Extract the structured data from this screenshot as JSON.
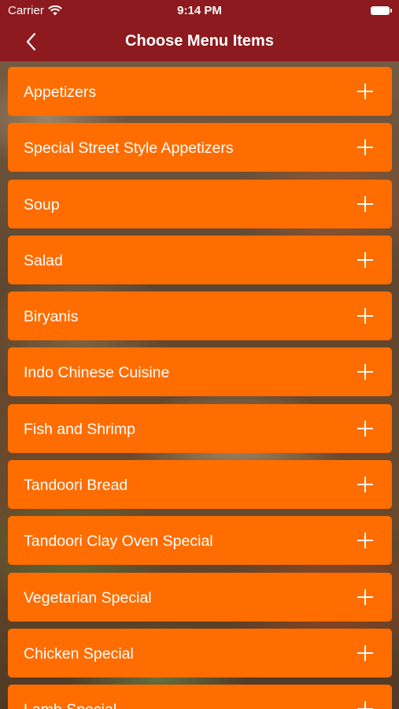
{
  "status_bar": {
    "carrier": "Carrier",
    "time": "9:14 PM"
  },
  "nav": {
    "title": "Choose Menu Items"
  },
  "colors": {
    "nav_background": "#8c1a1f",
    "item_background": "#ff6d00",
    "text": "#ffffff"
  },
  "menu_items": [
    {
      "label": "Appetizers",
      "icon": "plus-icon"
    },
    {
      "label": "Special Street Style Appetizers",
      "icon": "plus-icon"
    },
    {
      "label": "Soup",
      "icon": "plus-icon"
    },
    {
      "label": "Salad",
      "icon": "plus-icon"
    },
    {
      "label": "Biryanis",
      "icon": "plus-icon"
    },
    {
      "label": "Indo Chinese Cuisine",
      "icon": "plus-icon"
    },
    {
      "label": "Fish and Shrimp",
      "icon": "plus-icon"
    },
    {
      "label": "Tandoori Bread",
      "icon": "plus-icon"
    },
    {
      "label": "Tandoori Clay Oven Special",
      "icon": "plus-icon"
    },
    {
      "label": "Vegetarian Special",
      "icon": "plus-icon"
    },
    {
      "label": "Chicken Special",
      "icon": "plus-icon"
    },
    {
      "label": "Lamb Special",
      "icon": "plus-icon"
    }
  ]
}
